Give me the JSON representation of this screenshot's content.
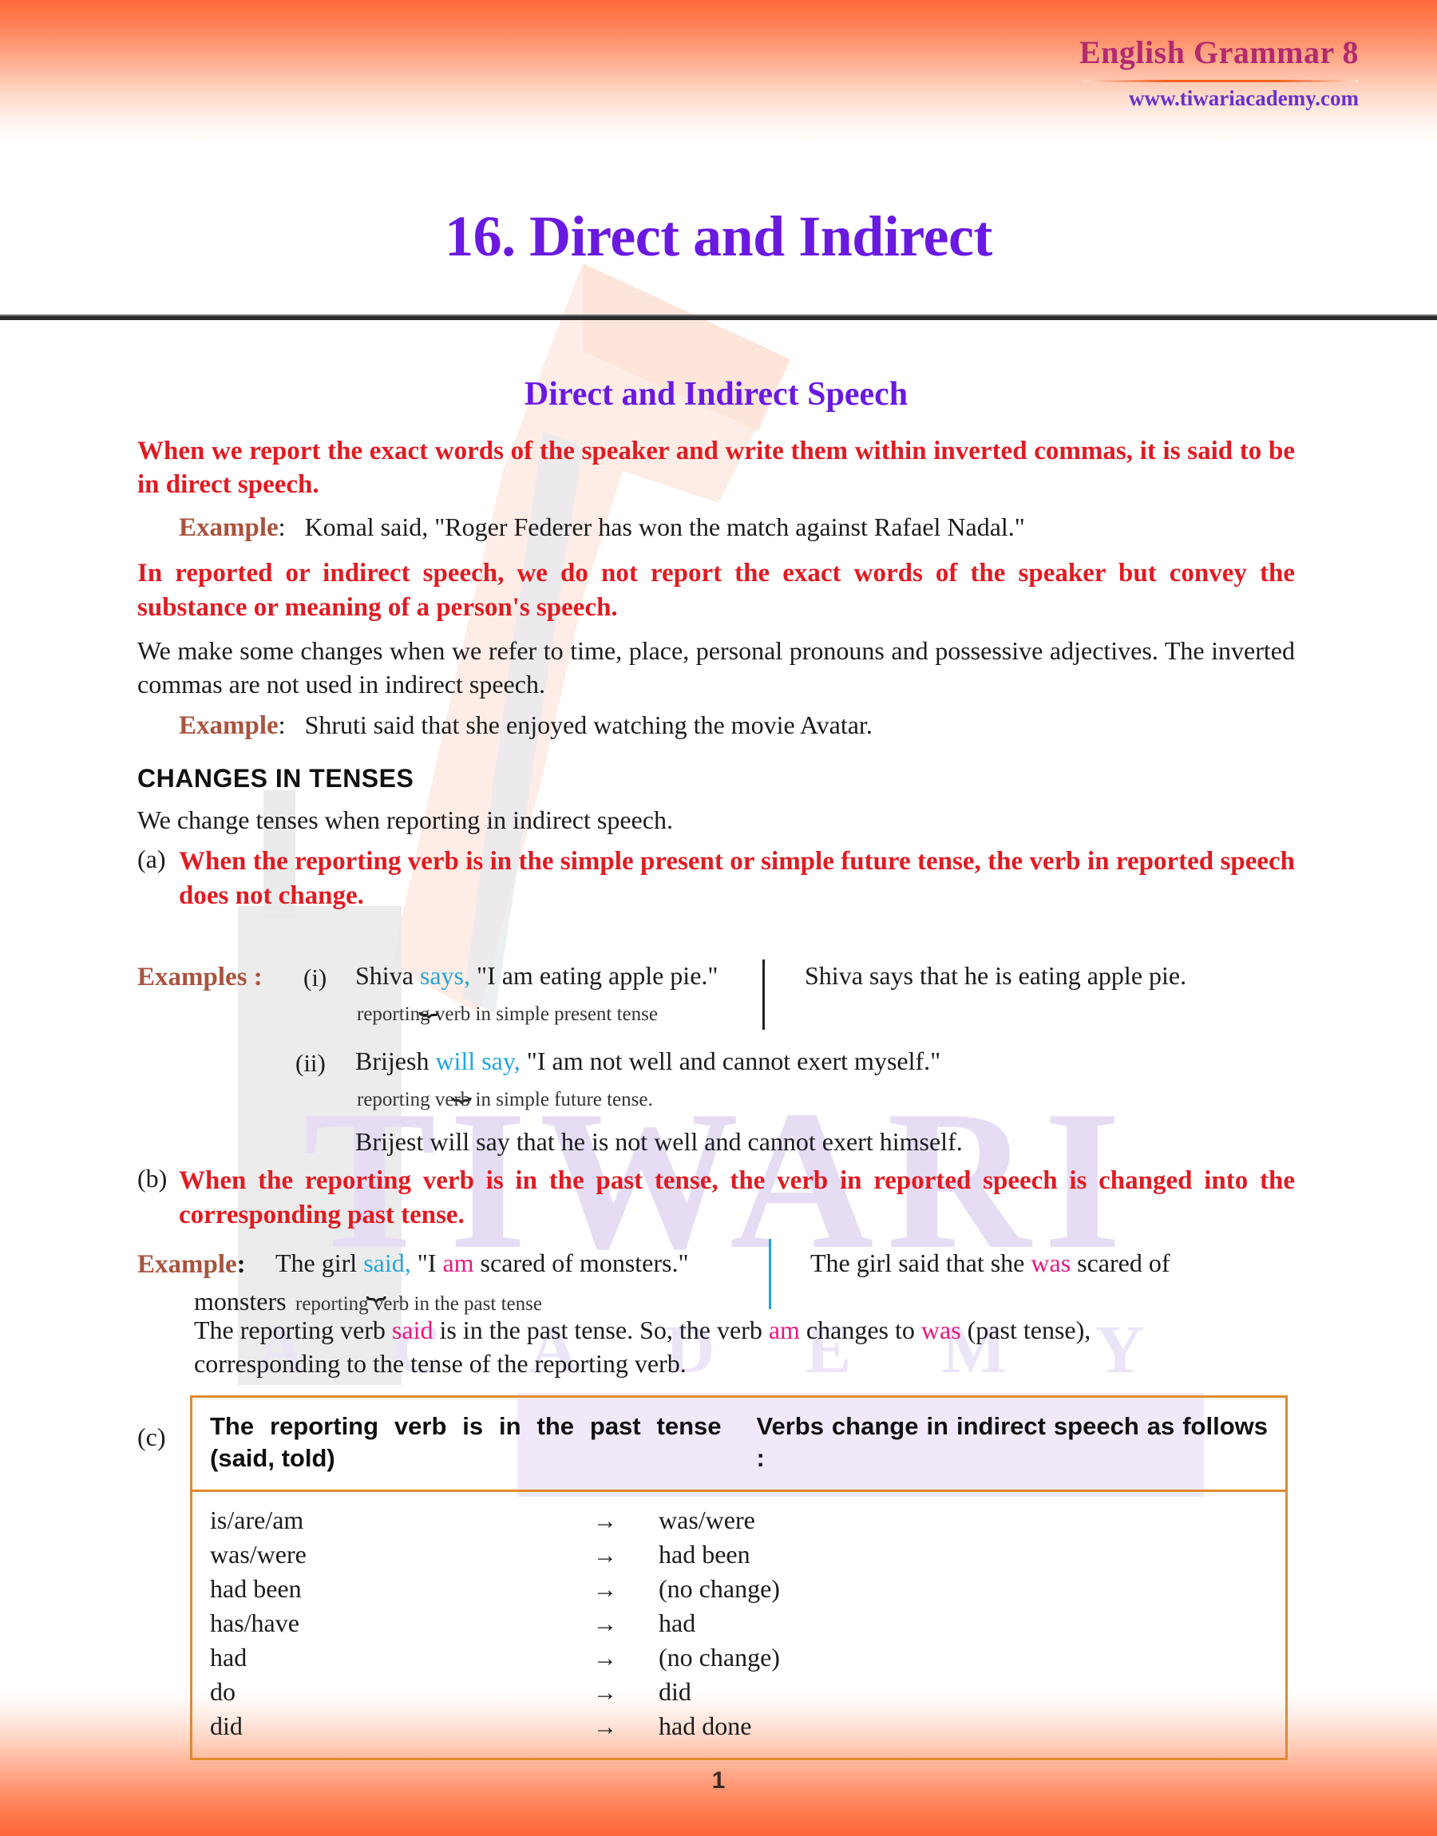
{
  "header": {
    "book_title": "English Grammar 8",
    "website": "www.tiwariacademy.com"
  },
  "chapter": {
    "title": "16. Direct and Indirect"
  },
  "section": {
    "heading": "Direct and Indirect Speech"
  },
  "intro": {
    "direct_rule": "When we report the exact words of the speaker and write them within inverted commas, it is said to be in direct speech.",
    "example_label": "Example",
    "colon": ":",
    "direct_example": "Komal said, \"Roger Federer has won the match against Rafael Nadal.\"",
    "indirect_rule": "In reported or indirect speech, we do not report the exact words of the speaker but convey the substance or meaning of a person's speech.",
    "changes_note": "We make some changes when we refer to time, place, personal pronouns and possessive adjectives. The inverted commas are not used in indirect speech.",
    "indirect_example": "Shruti said that she enjoyed watching the movie Avatar."
  },
  "tenses": {
    "heading": "CHANGES IN TENSES",
    "lead": "We change tenses when reporting in indirect speech.",
    "clause_a_marker": "(a)",
    "clause_a_text": "When the reporting verb is in the simple present or simple future tense, the verb in reported speech does not change.",
    "examples_label": "Examples :",
    "example_i": {
      "roman": "(i)",
      "direct_pre": "Shiva ",
      "direct_verb": "says,",
      "direct_post": " \"I am eating apple pie.\"",
      "annotation": "reporting verb in simple present tense",
      "indirect": "Shiva says that he is eating apple pie."
    },
    "example_ii": {
      "roman": "(ii)",
      "direct_pre": "Brijesh ",
      "direct_verb": "will say,",
      "direct_post": " \"I am not well and cannot exert myself.\"",
      "annotation": "reporting verb in simple future tense.",
      "indirect": "Brijest will say that he is not well and cannot exert himself."
    },
    "clause_b_marker": "(b)",
    "clause_b_text": "When the reporting verb is in the past tense, the verb in reported speech is changed into the corresponding past tense.",
    "example_b": {
      "label": "Example",
      "colon": ":",
      "direct_pre": "The girl ",
      "direct_verb": "said,",
      "direct_mid": " \"I ",
      "direct_am": "am",
      "direct_post": " scared of monsters.\"",
      "wrap_word": "monsters",
      "annotation": "reporting verb in the past tense",
      "indirect_1": "The  girl  said  that  she  ",
      "indirect_was": "was",
      "indirect_2": "  scared  of"
    },
    "explanation_1": "The  reporting  verb  ",
    "explanation_said": "said",
    "explanation_2": "  is  in  the  past  tense.  So,  the  verb  ",
    "explanation_am": "am",
    "explanation_3": "  changes  to  ",
    "explanation_was": "was",
    "explanation_4": "  (past  tense),",
    "explanation_5": "corresponding to the tense of the reporting verb."
  },
  "table": {
    "clause_c_marker": "(c)",
    "header_left": "The  reporting  verb  is  in  the  past tense (said, told)",
    "header_right": "Verbs change in indirect speech as follows :",
    "arrow": "→",
    "rows": [
      {
        "from": "is/are/am",
        "to": "was/were"
      },
      {
        "from": "was/were",
        "to": "had been"
      },
      {
        "from": "had been",
        "to": "(no change)"
      },
      {
        "from": "has/have",
        "to": "had"
      },
      {
        "from": "had",
        "to": "(no change)"
      },
      {
        "from": "do",
        "to": "did"
      },
      {
        "from": "did",
        "to": "had done"
      }
    ]
  },
  "watermark": {
    "line1": "TIWARI",
    "line2": "A C A D E M Y"
  },
  "footer": {
    "page_number": "1"
  },
  "colors": {
    "accent_purple": "#6a1ae0",
    "heading_magenta": "#b32a6e",
    "rule_orange": "#f2601f",
    "red_bold": "#e01b22",
    "example_brown": "#a8543f",
    "teal": "#24a5dc",
    "pink": "#e8197f",
    "table_border": "#e08a2e"
  }
}
